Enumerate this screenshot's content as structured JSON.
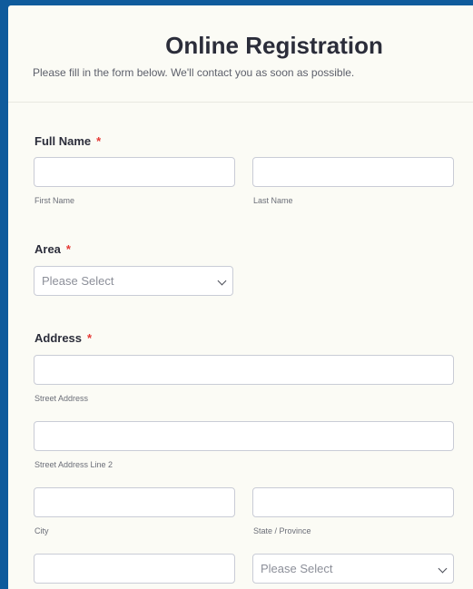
{
  "header": {
    "title": "Online Registration",
    "subtitle": "Please fill in the form below. We'll contact you as soon as possible."
  },
  "full_name": {
    "label": "Full Name",
    "required_mark": "*",
    "first_sublabel": "First Name",
    "last_sublabel": "Last Name"
  },
  "area": {
    "label": "Area",
    "required_mark": "*",
    "placeholder": "Please Select"
  },
  "address": {
    "label": "Address",
    "required_mark": "*",
    "street_sublabel": "Street Address",
    "street2_sublabel": "Street Address Line 2",
    "city_sublabel": "City",
    "state_sublabel": "State / Province",
    "country_placeholder": "Please Select"
  },
  "colors": {
    "background": "#0f5b9c",
    "card": "#fbfbf5",
    "required": "#e53935"
  }
}
